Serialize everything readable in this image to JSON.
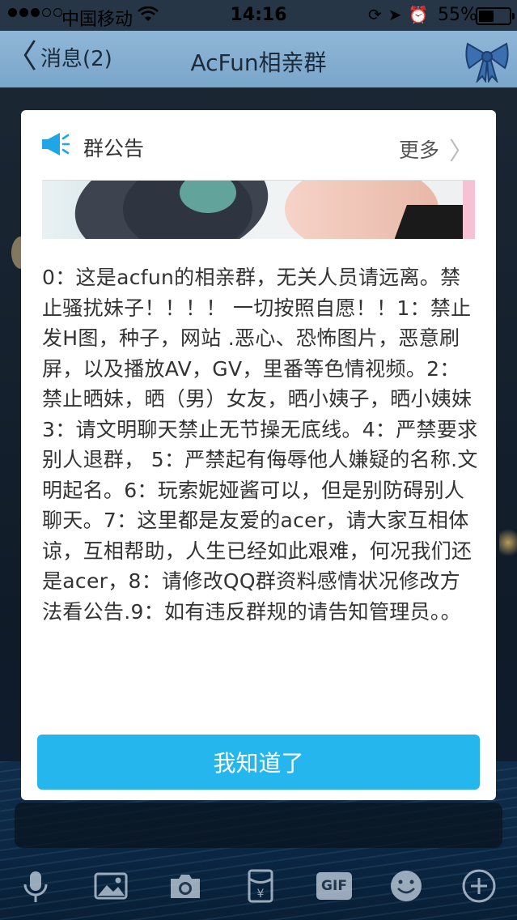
{
  "status_bar": {
    "carrier": "中国移动",
    "time": "14:16",
    "battery_percent_label": "55%",
    "battery_level": 0.55
  },
  "navbar": {
    "back_label": "消息(2)",
    "title": "AcFun相亲群",
    "right_icon": "bow-icon"
  },
  "notice": {
    "header_title": "群公告",
    "more_label": "更多",
    "body": "0：这是acfun的相亲群，无关人员请远离。禁止骚扰妹子！！！！ 一切按照自愿！！1：禁止发H图，种子，网站 .恶心、恐怖图片，恶意刷屏，以及播放AV，GV，里番等色情视频。2：禁止晒妹，晒（男）女友，晒小姨子，晒小姨妹 3：请文明聊天禁止无节操无底线。4：严禁要求别人退群， 5：严禁起有侮辱他人嫌疑的名称.文明起名。6：玩索妮娅酱可以，但是别防碍别人聊天。7：这里都是友爱的acer，请大家互相体谅，互相帮助，人生已经如此艰难，何况我们还是acer，8：请修改QQ群资料感情状况修改方法看公告.9：如有违反群规的请告知管理员。。",
    "confirm_label": "我知道了",
    "accent_color": "#26b6ee"
  },
  "toolbar": {
    "items": [
      "microphone-icon",
      "image-icon",
      "camera-icon",
      "red-packet-icon",
      "gif-icon",
      "emoji-icon",
      "plus-icon"
    ],
    "gif_label": "GIF"
  }
}
